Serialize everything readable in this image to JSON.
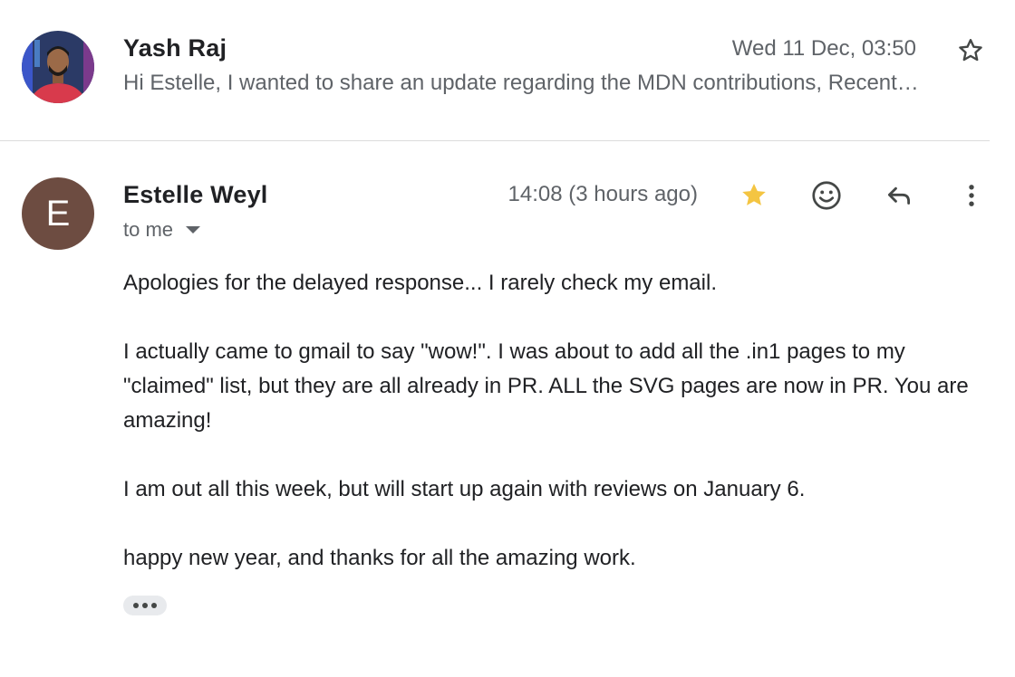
{
  "thread": {
    "collapsed_message": {
      "sender": "Yash Raj",
      "date": "Wed 11 Dec, 03:50",
      "snippet": "Hi Estelle, I wanted to share an update regarding the MDN contributions, Recent…",
      "star_icon": "star-outline-icon",
      "avatar": "profile-photo"
    },
    "expanded_message": {
      "sender": "Estelle Weyl",
      "avatar_letter": "E",
      "avatar_color": "#6d4c41",
      "time": "14:08 (3 hours ago)",
      "recipient": "to me",
      "star_color": "#f4c542",
      "actions": [
        "star-icon",
        "emoji-reaction-icon",
        "reply-icon",
        "more-vert-icon"
      ],
      "body": {
        "p1": "Apologies for the delayed response... I rarely check my email.",
        "p2": "I actually came to gmail to say \"wow!\". I was about to add all the .in1 pages to my \"claimed\" list, but they are all already in PR. ALL the SVG pages are now in PR. You are amazing!",
        "p3": "I am out all this week, but will start up again with reviews on January 6.",
        "p4": "happy new year, and thanks for all the amazing work."
      },
      "show_trimmed_icon": "more-horiz-icon"
    }
  }
}
